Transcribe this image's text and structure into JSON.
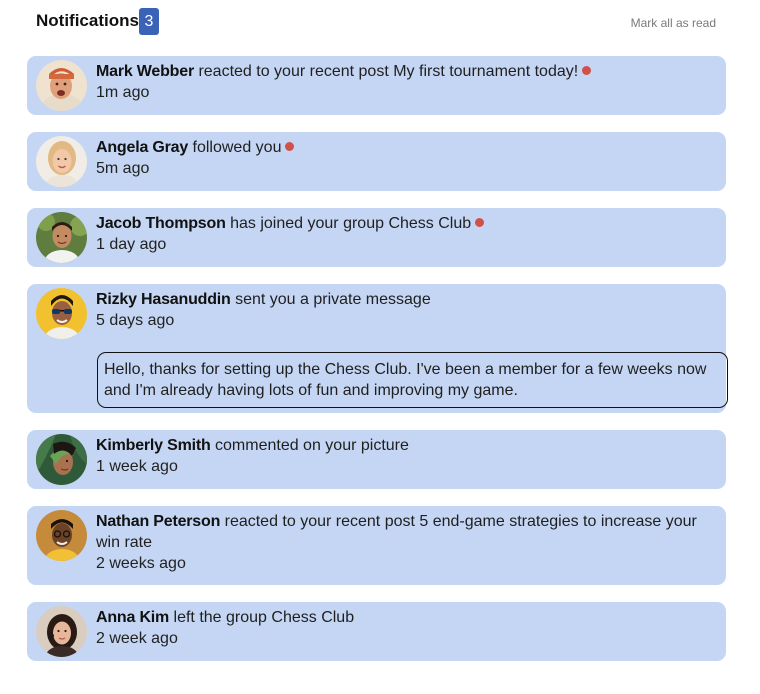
{
  "header": {
    "title": "Notifications",
    "count": "3",
    "mark_all": "Mark all as read"
  },
  "colors": {
    "card_bg": "#c4d6f3",
    "badge_bg": "#3a63b8",
    "unread_dot": "#d0504a"
  },
  "notifications": [
    {
      "name": "Mark Webber",
      "action": "reacted to your recent post",
      "target": "My first tournament today!",
      "time": "1m ago",
      "unread": true,
      "avatar_icon": "avatar-photo-mark-webber"
    },
    {
      "name": "Angela Gray",
      "action": "followed you",
      "target": "",
      "time": "5m ago",
      "unread": true,
      "avatar_icon": "avatar-photo-angela-gray"
    },
    {
      "name": "Jacob Thompson",
      "action": "has joined your group",
      "target": "Chess Club",
      "time": "1 day ago",
      "unread": true,
      "avatar_icon": "avatar-photo-jacob-thompson"
    },
    {
      "name": "Rizky Hasanuddin",
      "action": "sent you a private message",
      "target": "",
      "time": "5 days ago",
      "unread": false,
      "avatar_icon": "avatar-photo-rizky-hasanuddin",
      "message": "Hello, thanks for setting up the Chess Club. I've been a member for a few weeks now and I'm already having lots of fun and improving my game."
    },
    {
      "name": "Kimberly Smith",
      "action": "commented on your picture",
      "target": "",
      "time": "1 week ago",
      "unread": false,
      "avatar_icon": "avatar-photo-kimberly-smith"
    },
    {
      "name": "Nathan Peterson",
      "action": "reacted to your recent post",
      "target": "5 end-game strategies to increase your win rate",
      "time": "2 weeks ago",
      "unread": false,
      "avatar_icon": "avatar-photo-nathan-peterson"
    },
    {
      "name": "Anna Kim",
      "action": "left the group",
      "target": "Chess Club",
      "time": "2 week ago",
      "unread": false,
      "avatar_icon": "avatar-photo-anna-kim"
    }
  ]
}
